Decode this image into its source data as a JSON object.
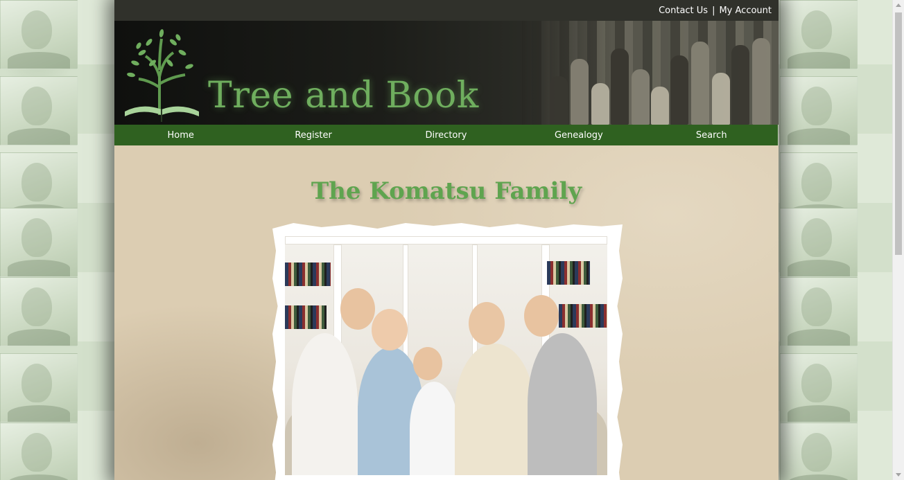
{
  "header": {
    "links": [
      {
        "label": "Contact Us"
      },
      {
        "label": "My Account"
      }
    ],
    "separator": "|",
    "site_title": "Tree and Book"
  },
  "nav": {
    "items": [
      {
        "label": "Home"
      },
      {
        "label": "Register"
      },
      {
        "label": "Directory"
      },
      {
        "label": "Genealogy"
      },
      {
        "label": "Search"
      }
    ]
  },
  "main": {
    "heading": "The Komatsu Family"
  },
  "colors": {
    "nav_green": "#2f6120",
    "title_green": "#5fa44f",
    "logo_green": "#6fae5e",
    "topbar": "#30312b"
  },
  "icons": {
    "logo": "tree-book-logo"
  }
}
